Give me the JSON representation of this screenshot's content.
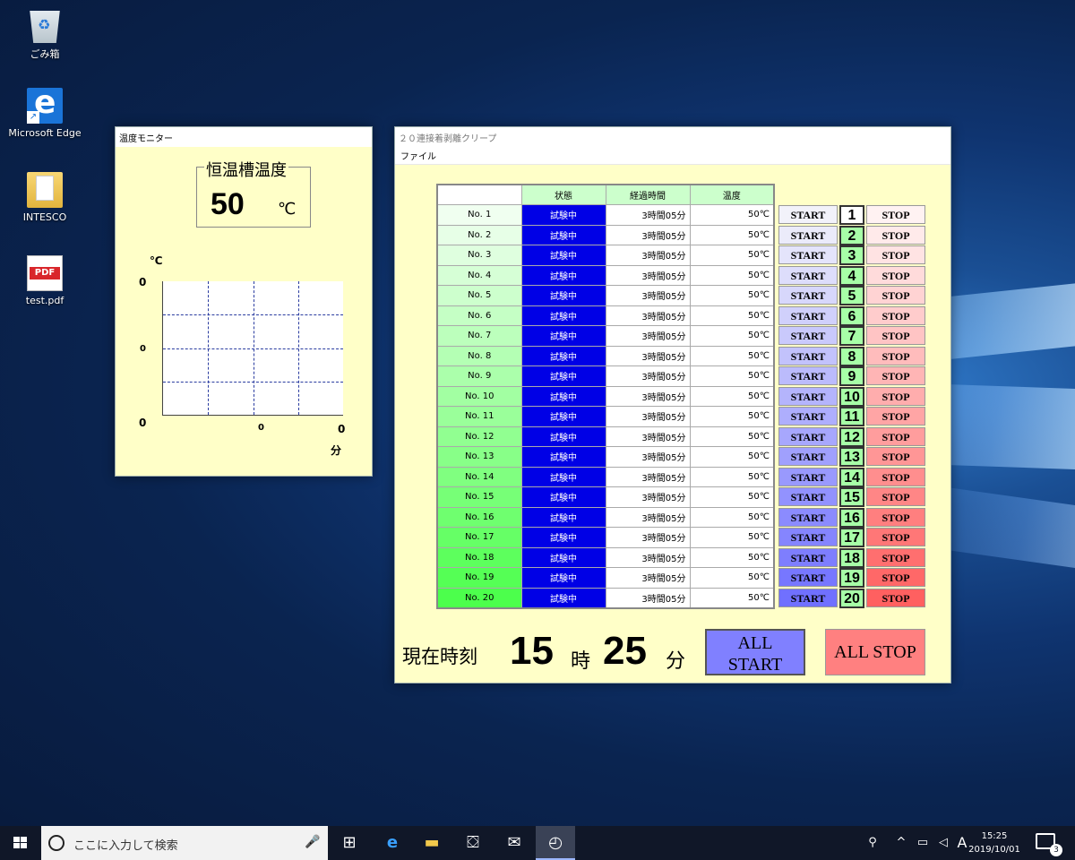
{
  "desktop": {
    "icons": [
      {
        "label": "ごみ箱",
        "icon": "recycle-bin-icon"
      },
      {
        "label": "Microsoft Edge",
        "icon": "edge-icon"
      },
      {
        "label": "INTESCO",
        "icon": "folder-icon"
      },
      {
        "label": "test.pdf",
        "icon": "pdf-icon"
      }
    ]
  },
  "monitor": {
    "title": "温度モニター",
    "box_title": "恒温槽温度",
    "value": "50",
    "unit": "℃",
    "chart_data": {
      "type": "line",
      "ylabel": "℃",
      "xlabel": "分",
      "y_ticks": [
        "0",
        "0",
        "0"
      ],
      "x_ticks": [
        "0",
        "0"
      ],
      "grid": true,
      "series": []
    }
  },
  "main": {
    "title": "２０連接着剥離クリープ",
    "menu": [
      "ファイル"
    ],
    "headers": [
      "",
      "状態",
      "経過時間",
      "温度"
    ],
    "rows": [
      {
        "no": "No. 1",
        "status": "試験中",
        "elapsed": "3時間05分",
        "temp": "50℃",
        "num": "1"
      },
      {
        "no": "No. 2",
        "status": "試験中",
        "elapsed": "3時間05分",
        "temp": "50℃",
        "num": "2"
      },
      {
        "no": "No. 3",
        "status": "試験中",
        "elapsed": "3時間05分",
        "temp": "50℃",
        "num": "3"
      },
      {
        "no": "No. 4",
        "status": "試験中",
        "elapsed": "3時間05分",
        "temp": "50℃",
        "num": "4"
      },
      {
        "no": "No. 5",
        "status": "試験中",
        "elapsed": "3時間05分",
        "temp": "50℃",
        "num": "5"
      },
      {
        "no": "No. 6",
        "status": "試験中",
        "elapsed": "3時間05分",
        "temp": "50℃",
        "num": "6"
      },
      {
        "no": "No. 7",
        "status": "試験中",
        "elapsed": "3時間05分",
        "temp": "50℃",
        "num": "7"
      },
      {
        "no": "No. 8",
        "status": "試験中",
        "elapsed": "3時間05分",
        "temp": "50℃",
        "num": "8"
      },
      {
        "no": "No. 9",
        "status": "試験中",
        "elapsed": "3時間05分",
        "temp": "50℃",
        "num": "9"
      },
      {
        "no": "No. 10",
        "status": "試験中",
        "elapsed": "3時間05分",
        "temp": "50℃",
        "num": "10"
      },
      {
        "no": "No. 11",
        "status": "試験中",
        "elapsed": "3時間05分",
        "temp": "50℃",
        "num": "11"
      },
      {
        "no": "No. 12",
        "status": "試験中",
        "elapsed": "3時間05分",
        "temp": "50℃",
        "num": "12"
      },
      {
        "no": "No. 13",
        "status": "試験中",
        "elapsed": "3時間05分",
        "temp": "50℃",
        "num": "13"
      },
      {
        "no": "No. 14",
        "status": "試験中",
        "elapsed": "3時間05分",
        "temp": "50℃",
        "num": "14"
      },
      {
        "no": "No. 15",
        "status": "試験中",
        "elapsed": "3時間05分",
        "temp": "50℃",
        "num": "15"
      },
      {
        "no": "No. 16",
        "status": "試験中",
        "elapsed": "3時間05分",
        "temp": "50℃",
        "num": "16"
      },
      {
        "no": "No. 17",
        "status": "試験中",
        "elapsed": "3時間05分",
        "temp": "50℃",
        "num": "17"
      },
      {
        "no": "No. 18",
        "status": "試験中",
        "elapsed": "3時間05分",
        "temp": "50℃",
        "num": "18"
      },
      {
        "no": "No. 19",
        "status": "試験中",
        "elapsed": "3時間05分",
        "temp": "50℃",
        "num": "19"
      },
      {
        "no": "No. 20",
        "status": "試験中",
        "elapsed": "3時間05分",
        "temp": "50℃",
        "num": "20"
      }
    ],
    "start_label": "START",
    "stop_label": "STOP",
    "clock": {
      "label": "現在時刻",
      "hour": "15",
      "hour_unit": "時",
      "minute": "25",
      "minute_unit": "分"
    },
    "all_start": [
      "ALL",
      "START"
    ],
    "all_stop": "ALL STOP",
    "colors": {
      "status_bg": "#0000e6",
      "window_bg": "#ffffc8",
      "all_start": "#8080ff",
      "all_stop": "#ff8080"
    }
  },
  "taskbar": {
    "search_placeholder": "ここに入力して検索",
    "apps": [
      "task-view-icon",
      "edge-icon",
      "explorer-icon",
      "store-icon",
      "mail-icon",
      "clock-app-icon"
    ],
    "ime": "A",
    "time": "15:25",
    "date": "2019/10/01",
    "notification_count": "3"
  }
}
